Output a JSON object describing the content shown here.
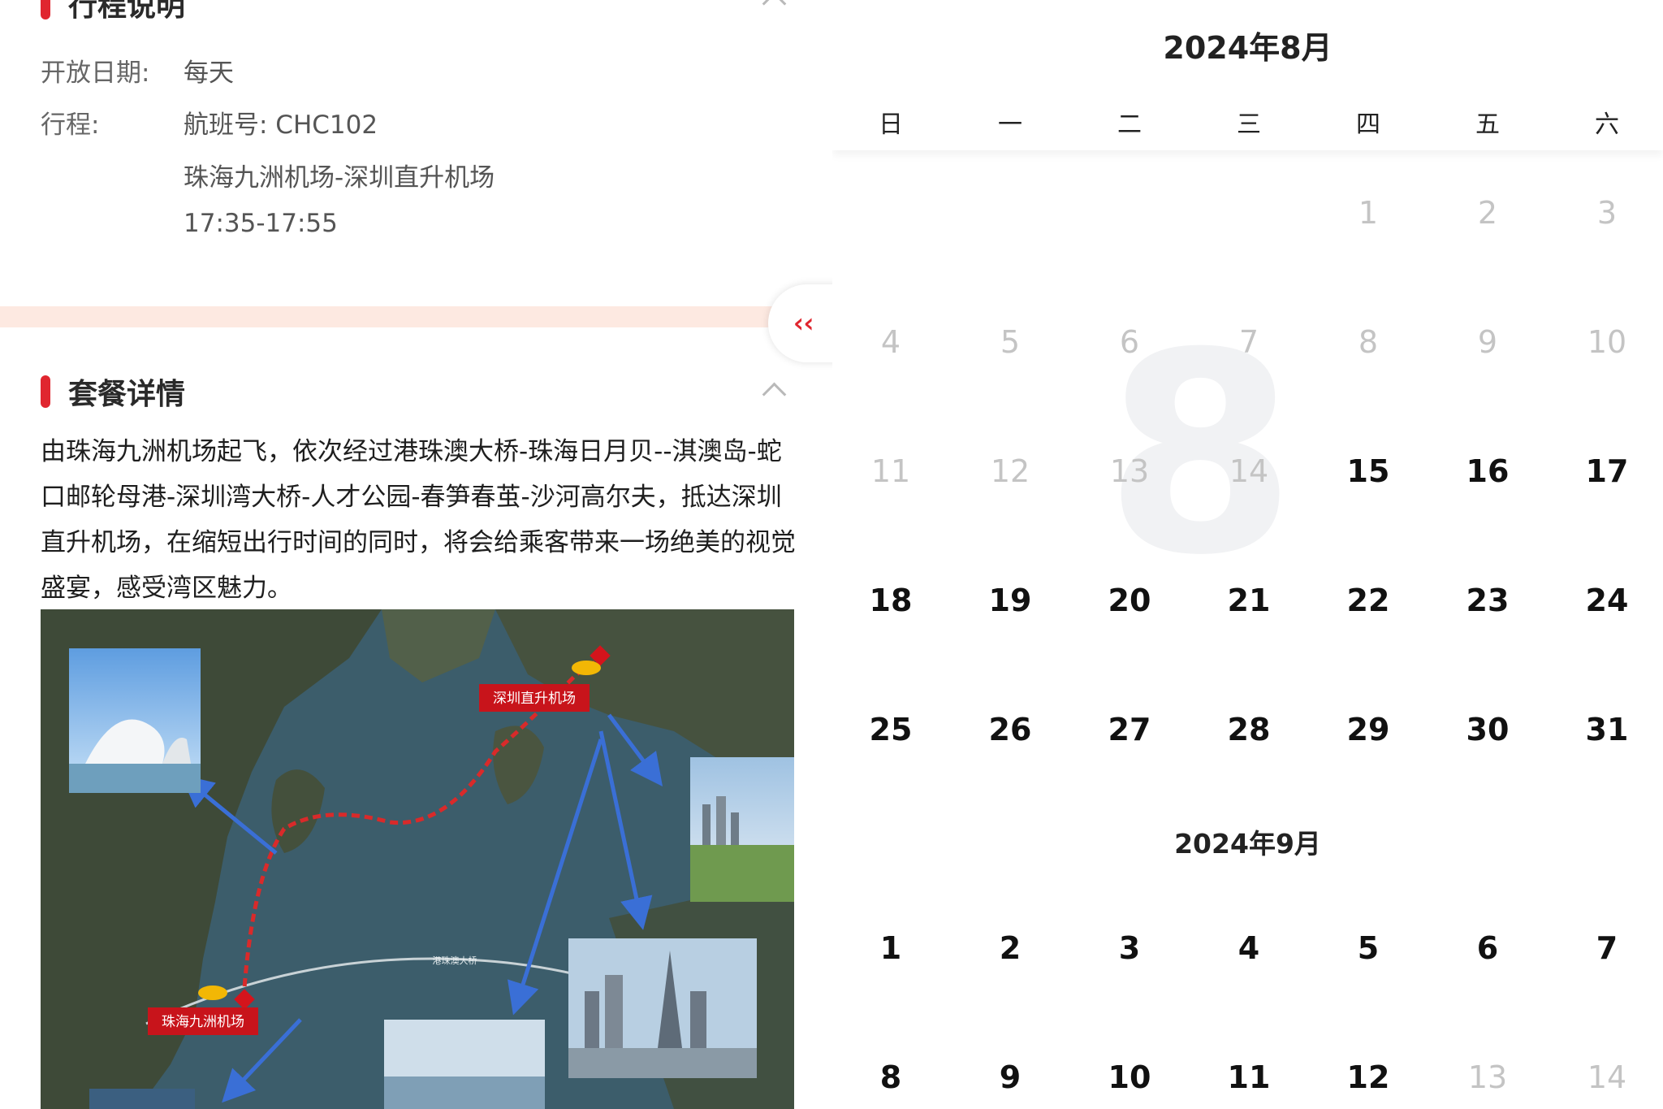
{
  "itinerary": {
    "section_title": "行程说明",
    "open_label": "开放日期:",
    "open_value": "每天",
    "route_label": "行程:",
    "flight": "航班号: CHC102",
    "route": "珠海九洲机场-深圳直升机场",
    "time": "17:35-17:55"
  },
  "package": {
    "section_title": "套餐详情",
    "description": "由珠海九洲机场起飞，依次经过港珠澳大桥-珠海日月贝--淇澳岛-蛇口邮轮母港-深圳湾大桥-人才公园-春笋春茧-沙河高尔夫，抵达深圳直升机场，在缩短出行时间的同时，将会给乘客带来一场绝美的视觉盛宴，感受湾区魅力。"
  },
  "map": {
    "origin_label": "珠海九洲机场",
    "destination_label": "深圳直升机场",
    "bridge_label": "港珠澳大桥",
    "colors": {
      "sea": "#3c5d6b",
      "land": "#3e4a38",
      "route": "#d92a2a",
      "arrow": "#3a6fd6",
      "label_bg": "#c8141b"
    }
  },
  "collapse_tab": {
    "icon": "double-chevron-left-icon",
    "glyph": "‹‹"
  },
  "calendar": {
    "weekdays": [
      "日",
      "一",
      "二",
      "三",
      "四",
      "五",
      "六"
    ],
    "months": [
      {
        "title": "2024年8月",
        "watermark": "8",
        "first_weekday": 4,
        "days": 31,
        "available_from": 15
      },
      {
        "title": "2024年9月",
        "first_weekday": 0,
        "visible_days": [
          1,
          2,
          3,
          4,
          5,
          6,
          7,
          8,
          9,
          10,
          11,
          12,
          13,
          14
        ],
        "unavailable_days": [
          13,
          14
        ]
      }
    ],
    "colors": {
      "available": "#111111",
      "unavailable": "#c4c4c4",
      "accent": "#e0262f"
    }
  }
}
